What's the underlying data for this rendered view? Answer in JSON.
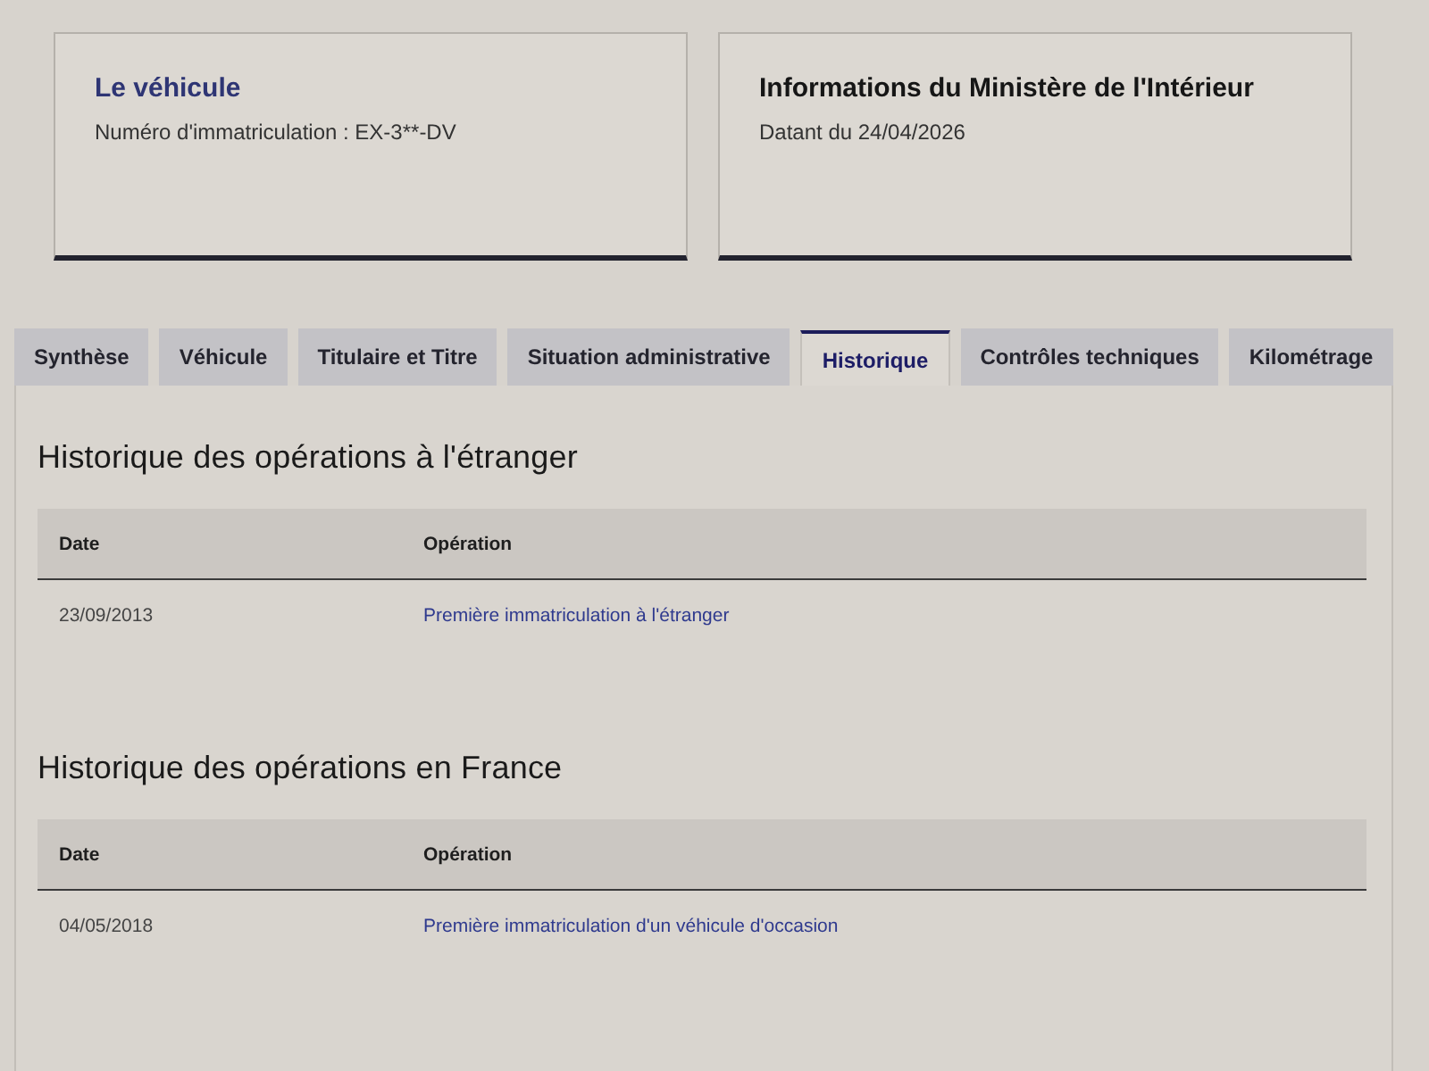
{
  "info_cards": [
    {
      "kind": "vehicle",
      "title": "Le véhicule",
      "text": "Numéro d'immatriculation : EX-3**-DV"
    },
    {
      "kind": "source",
      "title": "Informations du Ministère de l'Intérieur",
      "text": "Datant du 24/04/2026"
    }
  ],
  "tabs": [
    {
      "label": "Synthèse",
      "selected": false
    },
    {
      "label": "Véhicule",
      "selected": false
    },
    {
      "label": "Titulaire et Titre",
      "selected": false
    },
    {
      "label": "Situation administrative",
      "selected": false
    },
    {
      "label": "Historique",
      "selected": true
    },
    {
      "label": "Contrôles techniques",
      "selected": false
    },
    {
      "label": "Kilométrage",
      "selected": false
    }
  ],
  "sections": [
    {
      "title": "Historique des opérations à l'étranger",
      "table": {
        "columns": [
          "Date",
          "Opération"
        ],
        "rows": [
          {
            "date": "23/09/2013",
            "operation": "Première immatriculation à l'étranger"
          }
        ]
      }
    },
    {
      "title": "Historique des opérations en France",
      "table": {
        "columns": [
          "Date",
          "Opération"
        ],
        "rows": [
          {
            "date": "04/05/2018",
            "operation": "Première immatriculation d'un véhicule d'occasion"
          }
        ]
      }
    }
  ]
}
